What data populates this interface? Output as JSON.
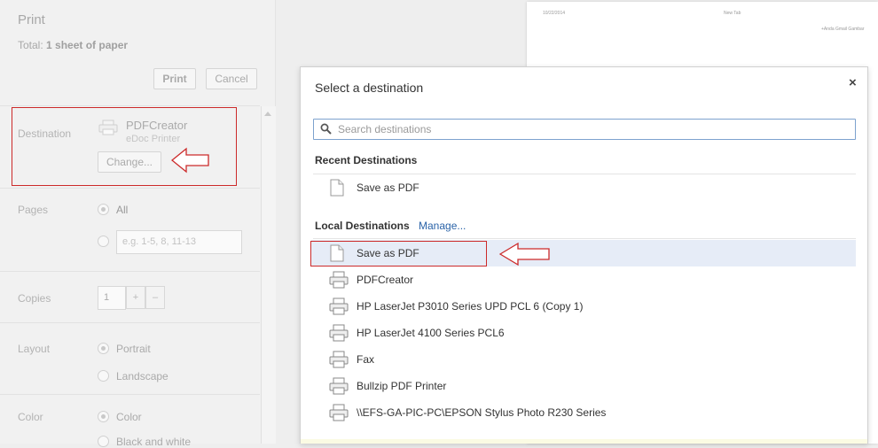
{
  "print_panel": {
    "title": "Print",
    "total_prefix": "Total:",
    "total_value": "1 sheet of paper",
    "print_button": "Print",
    "cancel_button": "Cancel",
    "destination": {
      "label": "Destination",
      "printer_name": "PDFCreator",
      "printer_subtitle": "eDoc Printer",
      "change_button": "Change..."
    },
    "pages": {
      "label": "Pages",
      "all_option": "All",
      "range_placeholder": "e.g. 1-5, 8, 11-13"
    },
    "copies": {
      "label": "Copies",
      "value": "1",
      "increment": "+",
      "decrement": "–"
    },
    "layout": {
      "label": "Layout",
      "portrait": "Portrait",
      "landscape": "Landscape"
    },
    "color": {
      "label": "Color",
      "color_option": "Color",
      "bw_option": "Black and white"
    }
  },
  "preview": {
    "date": "10/22/2014",
    "tab_title": "New Tab",
    "links": "+Anda  Gmail  Gambar"
  },
  "dialog": {
    "title": "Select a destination",
    "close_symbol": "×",
    "search_placeholder": "Search destinations",
    "recent_heading": "Recent Destinations",
    "recent": [
      {
        "label": "Save as PDF",
        "icon": "document-icon"
      }
    ],
    "local_heading": "Local Destinations",
    "manage_link": "Manage...",
    "local": [
      {
        "label": "Save as PDF",
        "icon": "document-icon"
      },
      {
        "label": "PDFCreator",
        "icon": "printer-icon"
      },
      {
        "label": "HP LaserJet P3010 Series UPD PCL 6 (Copy 1)",
        "icon": "printer-icon"
      },
      {
        "label": "HP LaserJet 4100 Series PCL6",
        "icon": "printer-icon"
      },
      {
        "label": "Fax",
        "icon": "printer-icon"
      },
      {
        "label": "Bullzip PDF Printer",
        "icon": "printer-icon"
      },
      {
        "label": "\\\\EFS-GA-PIC-PC\\EPSON Stylus Photo R230 Series",
        "icon": "printer-icon"
      }
    ]
  },
  "colors": {
    "selected_row": "#e6ecf7",
    "annotation_red": "#cc2a2a",
    "link_blue": "#2a63a8",
    "search_border": "#7da2ce"
  }
}
